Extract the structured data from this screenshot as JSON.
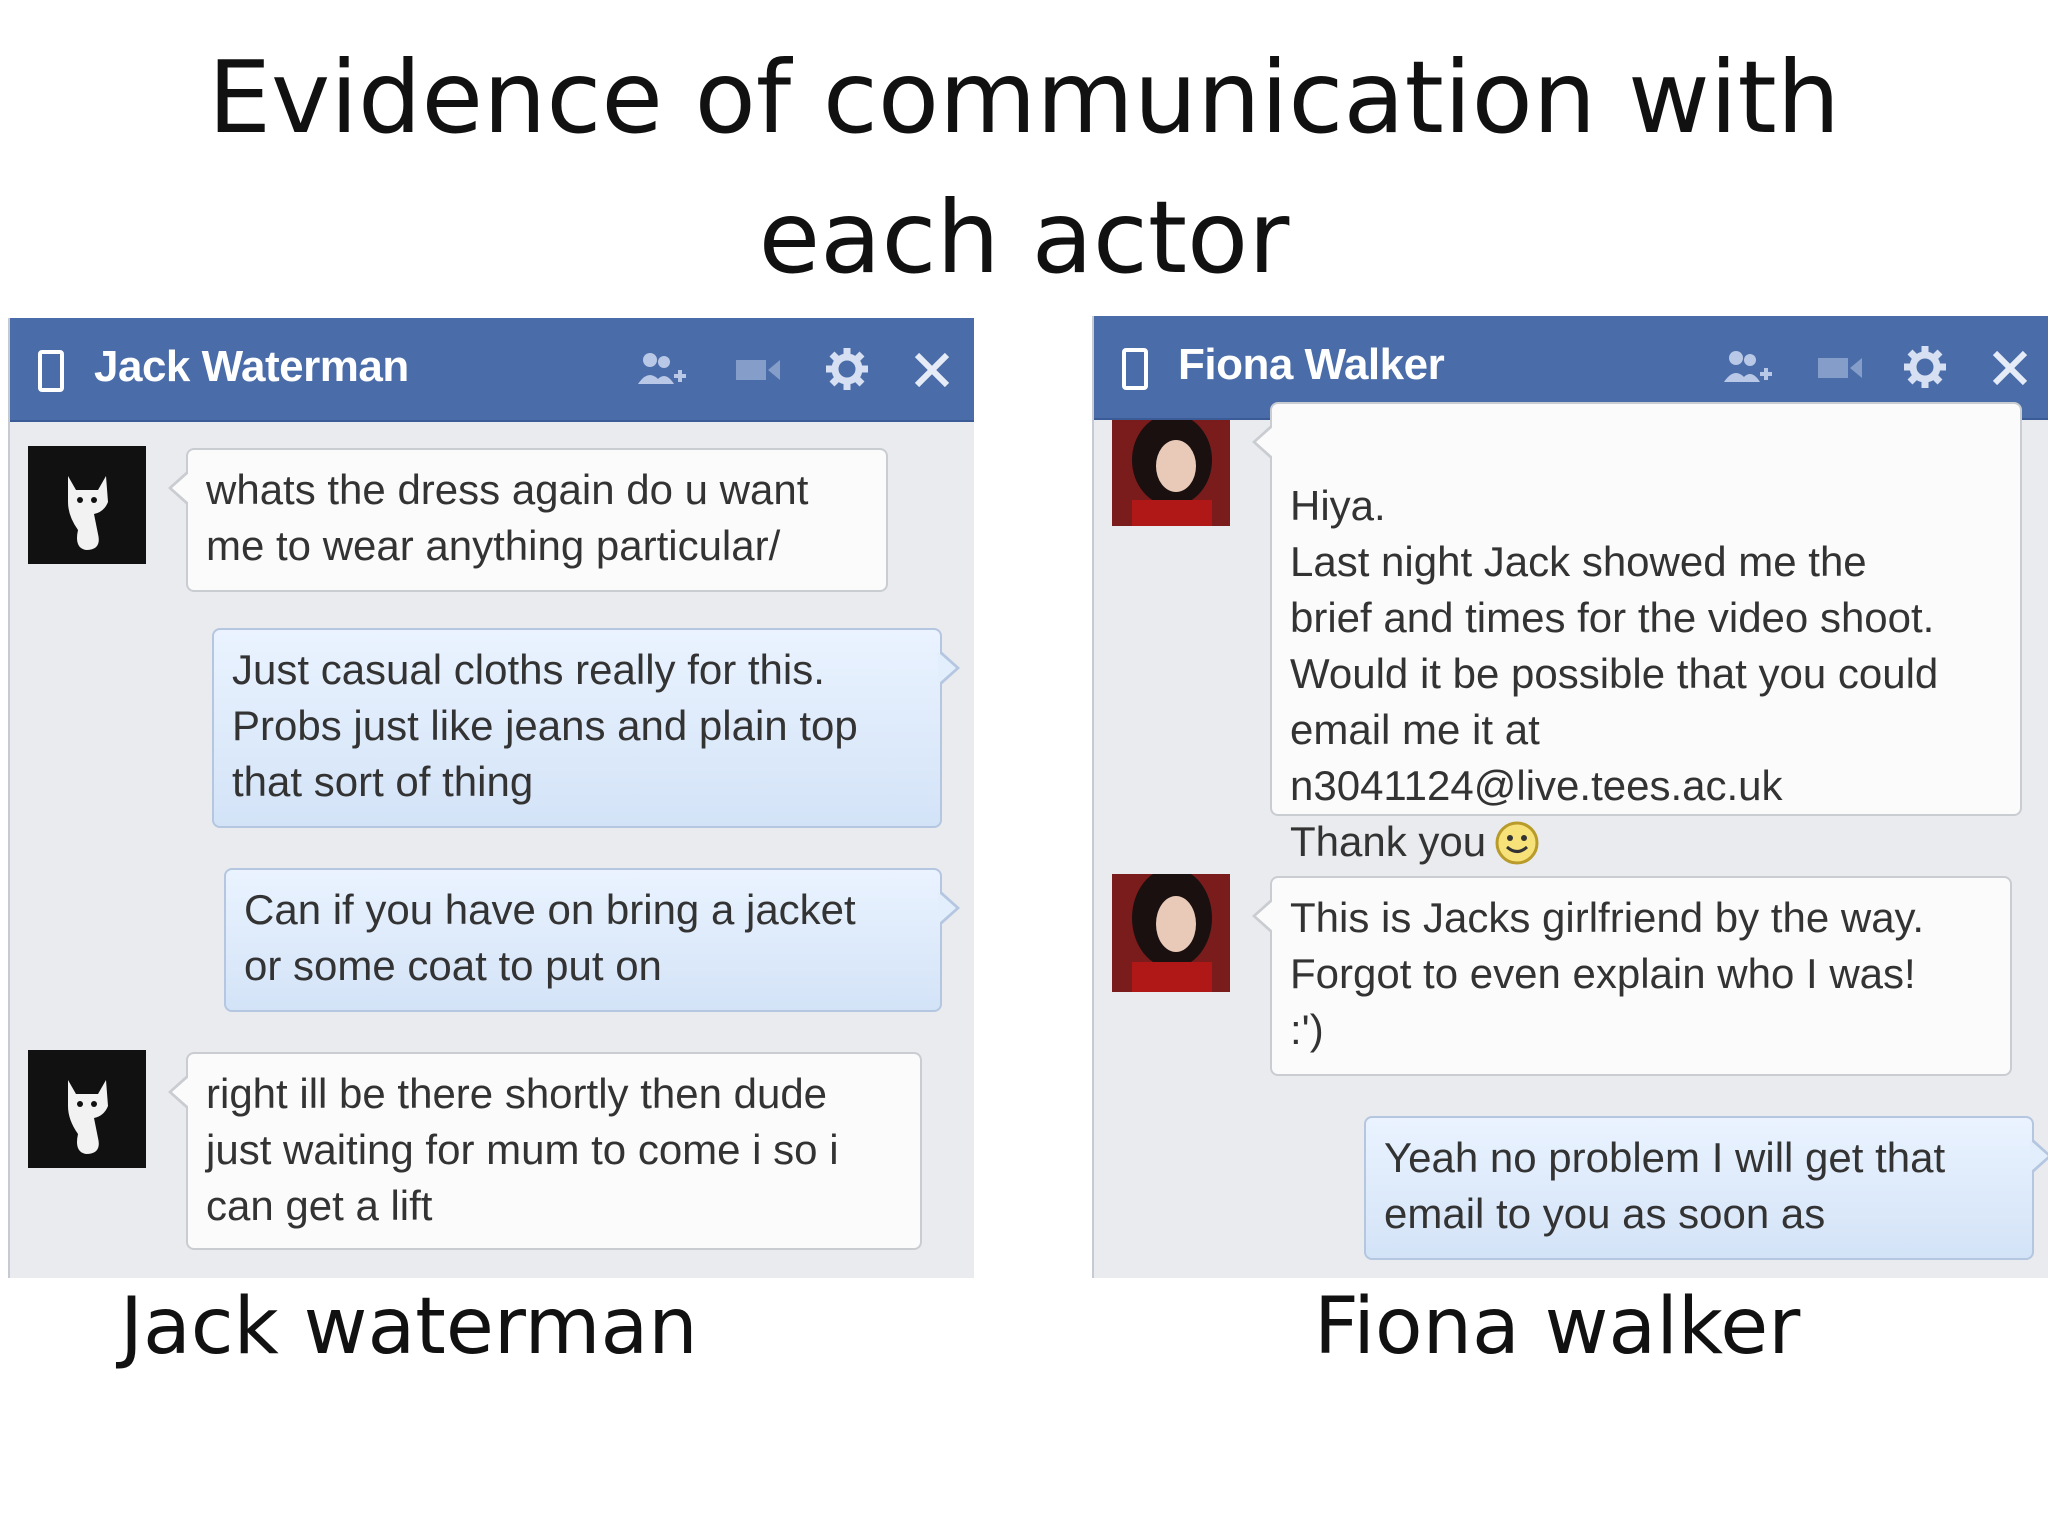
{
  "slide": {
    "title": "Evidence of communication with each actor"
  },
  "captions": {
    "left": "Jack waterman",
    "right": "Fiona walker"
  },
  "chat_jack": {
    "name": "Jack Waterman",
    "icons": [
      "phone-icon",
      "add-friend-icon",
      "video-icon",
      "gear-icon",
      "close-icon"
    ],
    "messages": [
      {
        "side": "incoming",
        "text": "whats the dress again do u want\nme to wear anything particular/"
      },
      {
        "side": "outgoing",
        "text": "Just casual cloths really for this.\nProbs just like jeans and plain top\nthat sort of thing"
      },
      {
        "side": "outgoing",
        "text": "Can if you have on bring a jacket\nor some coat to put on"
      },
      {
        "side": "incoming",
        "text": "right ill be there shortly then dude\njust waiting for mum to come i so i\ncan get a lift"
      }
    ]
  },
  "chat_fiona": {
    "name": "Fiona Walker",
    "icons": [
      "phone-icon",
      "add-friend-icon",
      "video-icon",
      "gear-icon",
      "close-icon"
    ],
    "messages": [
      {
        "side": "incoming",
        "text": "Hiya.\nLast night Jack showed me the\nbrief and times for the video shoot.\nWould it be possible that you could\nemail me it at\nn3041124@live.tees.ac.uk\nThank you"
      },
      {
        "side": "incoming",
        "text": "This is Jacks girlfriend by the way.\nForgot to even explain who I was!\n:')"
      },
      {
        "side": "outgoing",
        "text": "Yeah no problem I will get that\nemail to you as soon as"
      }
    ]
  },
  "colors": {
    "header_blue": "#4a6ca8",
    "chat_background": "#e9ebee",
    "outgoing_bubble": "#d9e6f8",
    "incoming_bubble": "#fbfbfb"
  }
}
